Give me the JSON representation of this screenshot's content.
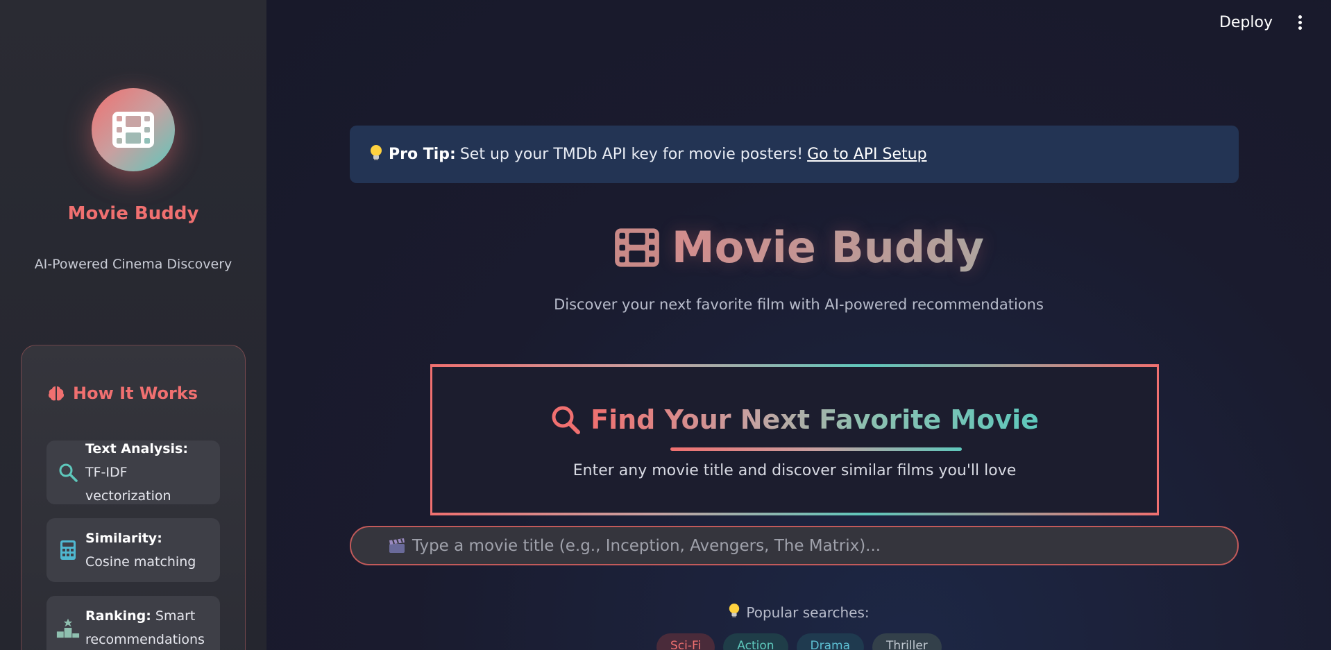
{
  "sidebar": {
    "logo_icon": "film-icon",
    "title": "Movie Buddy",
    "subtitle": "AI-Powered Cinema Discovery",
    "how_it_works": {
      "icon": "brain-icon",
      "heading": "How It Works",
      "features": [
        {
          "icon": "search-icon",
          "label": "Text Analysis:",
          "text": "TF-IDF vectorization"
        },
        {
          "icon": "calculator-icon",
          "label": "Similarity:",
          "text": "Cosine matching"
        },
        {
          "icon": "podium-icon",
          "label": "Ranking:",
          "text": "Smart recommendations"
        }
      ]
    }
  },
  "header": {
    "deploy_label": "Deploy",
    "menu_icon": "kebab-menu-icon"
  },
  "tip": {
    "icon": "lightbulb-icon",
    "label": "Pro Tip:",
    "text": "Set up your TMDb API key for movie posters!",
    "link": "Go to API Setup"
  },
  "hero": {
    "icon": "film-icon",
    "title": "Movie Buddy",
    "subtitle": "Discover your next favorite film with AI-powered recommendations"
  },
  "finder": {
    "icon": "search-icon",
    "title": "Find Your Next Favorite Movie",
    "subtitle": "Enter any movie title and discover similar films you'll love"
  },
  "search": {
    "icon": "clapperboard-icon",
    "placeholder": "Type a movie title (e.g., Inception, Avengers, The Matrix)..."
  },
  "popular": {
    "icon": "lightbulb-icon",
    "label": "Popular searches:",
    "chips": [
      "Sci-Fi",
      "Action",
      "Drama",
      "Thriller"
    ]
  },
  "colors": {
    "accent_red": "#f07070",
    "accent_teal": "#5ec8bc",
    "tip_bg": "#233454",
    "bg": "#1a1b2e"
  }
}
